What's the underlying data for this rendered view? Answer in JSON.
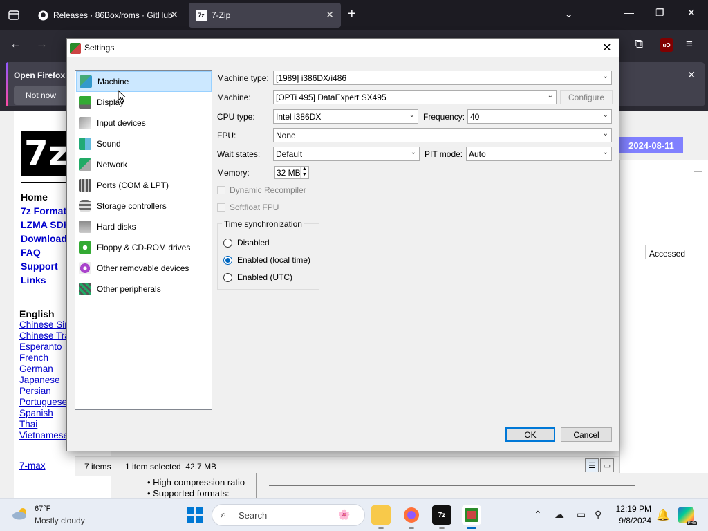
{
  "browser": {
    "tabs": [
      {
        "label": "Releases · 86Box/roms · GitHub",
        "icon": "github-icon"
      },
      {
        "label": "7-Zip",
        "icon": "7zip-icon"
      }
    ],
    "notice": {
      "text": "Open Firefox",
      "button": "Not now"
    },
    "ublock_label": "uO"
  },
  "webpage": {
    "logo": "7z",
    "nav": [
      "Home",
      "7z Format",
      "LZMA SDK",
      "Download",
      "FAQ",
      "Support",
      "Links"
    ],
    "languages_heading": "English",
    "languages": [
      "Chinese Simpl.",
      "Chinese Trad.",
      "Esperanto",
      "French",
      "German",
      "Japanese",
      "Persian",
      "Portuguese",
      "Spanish",
      "Thai",
      "Vietnamese"
    ],
    "extra_link": "7-max",
    "date_badge": "2024-08-11",
    "bullets": [
      "High compression ratio",
      "Supported formats:"
    ]
  },
  "file_manager": {
    "column_accessed": "Accessed",
    "status_items": "7 items",
    "status_selected": "1 item selected  42.7 MB"
  },
  "dialog": {
    "title": "Settings",
    "categories": [
      {
        "label": "Machine",
        "selected": true
      },
      {
        "label": "Display",
        "selected": false
      },
      {
        "label": "Input devices",
        "selected": false
      },
      {
        "label": "Sound",
        "selected": false
      },
      {
        "label": "Network",
        "selected": false
      },
      {
        "label": "Ports (COM & LPT)",
        "selected": false
      },
      {
        "label": "Storage controllers",
        "selected": false
      },
      {
        "label": "Hard disks",
        "selected": false
      },
      {
        "label": "Floppy & CD-ROM drives",
        "selected": false
      },
      {
        "label": "Other removable devices",
        "selected": false
      },
      {
        "label": "Other peripherals",
        "selected": false
      }
    ],
    "fields": {
      "machine_type_label": "Machine type:",
      "machine_type_value": "[1989] i386DX/i486",
      "machine_label": "Machine:",
      "machine_value": "[OPTi 495] DataExpert SX495",
      "configure_button": "Configure",
      "cpu_type_label": "CPU type:",
      "cpu_type_value": "Intel i386DX",
      "frequency_label": "Frequency:",
      "frequency_value": "40",
      "fpu_label": "FPU:",
      "fpu_value": "None",
      "wait_states_label": "Wait states:",
      "wait_states_value": "Default",
      "pit_mode_label": "PIT mode:",
      "pit_mode_value": "Auto",
      "memory_label": "Memory:",
      "memory_value": "32 MB"
    },
    "checkboxes": [
      {
        "label": "Dynamic Recompiler",
        "checked": false,
        "enabled": false
      },
      {
        "label": "Softfloat FPU",
        "checked": false,
        "enabled": false
      }
    ],
    "time_sync": {
      "title": "Time synchronization",
      "options": [
        "Disabled",
        "Enabled (local time)",
        "Enabled (UTC)"
      ],
      "selected": "Enabled (local time)"
    },
    "ok_button": "OK",
    "cancel_button": "Cancel"
  },
  "taskbar": {
    "weather_temp": "67°F",
    "weather_condition": "Mostly cloudy",
    "search_placeholder": "Search",
    "clock_time": "12:19 PM",
    "clock_date": "9/8/2024",
    "seven_zip_app_label": "7z",
    "copilot_badge": "PRE"
  },
  "colors": {
    "accent": "#0067c0",
    "selection": "#cce8ff",
    "link": "#0000cd",
    "browser_dark": "#1c1b22"
  }
}
